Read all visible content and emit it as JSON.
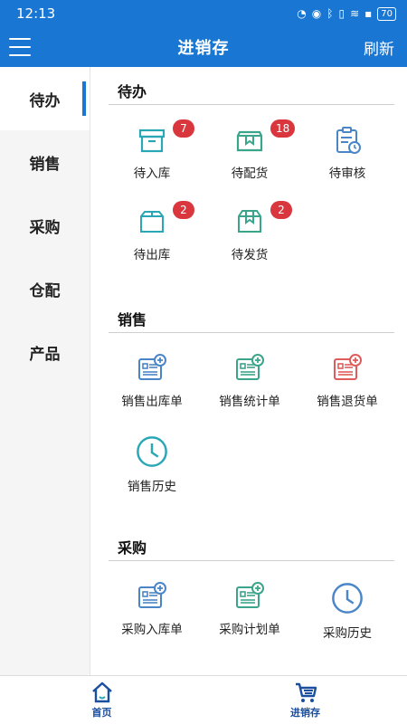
{
  "status_bar": {
    "time": "12:13",
    "battery": "70",
    "icons": [
      "signal-icon",
      "eye-icon",
      "bluetooth-icon",
      "vibrate-icon",
      "wifi-icon",
      "battery-icon"
    ]
  },
  "header": {
    "title": "进销存",
    "refresh_label": "刷新"
  },
  "sidebar": {
    "items": [
      {
        "label": "待办",
        "active": true
      },
      {
        "label": "销售"
      },
      {
        "label": "采购"
      },
      {
        "label": "仓配"
      },
      {
        "label": "产品"
      }
    ]
  },
  "sections": {
    "todo": {
      "title": "待办",
      "items": [
        {
          "label": "待入库",
          "badge": "7",
          "icon": "box-icon"
        },
        {
          "label": "待配货",
          "badge": "18",
          "icon": "package-icon"
        },
        {
          "label": "待审核",
          "icon": "clipboard-clock-icon"
        },
        {
          "label": "待出库",
          "badge": "2",
          "icon": "box-outline-icon"
        },
        {
          "label": "待发货",
          "badge": "2",
          "icon": "package-outline-icon"
        }
      ]
    },
    "sales": {
      "title": "销售",
      "items": [
        {
          "label": "销售出库单",
          "icon": "form-add-icon"
        },
        {
          "label": "销售统计单",
          "icon": "form-add-icon"
        },
        {
          "label": "销售退货单",
          "icon": "form-add-red-icon"
        },
        {
          "label": "销售历史",
          "icon": "clock-icon"
        }
      ]
    },
    "purchase": {
      "title": "采购",
      "items": [
        {
          "label": "采购入库单",
          "icon": "form-add-icon"
        },
        {
          "label": "采购计划单",
          "icon": "form-add-icon"
        },
        {
          "label": "采购历史",
          "icon": "clock-icon"
        }
      ]
    }
  },
  "bottom_nav": {
    "items": [
      {
        "label": "首页",
        "icon": "home-icon"
      },
      {
        "label": "进销存",
        "icon": "cart-icon"
      }
    ]
  },
  "colors": {
    "primary": "#1976d2",
    "teal": "#2aa7b5",
    "green": "#3aa58a",
    "red": "#e05b5b",
    "badge": "#d9363e"
  }
}
